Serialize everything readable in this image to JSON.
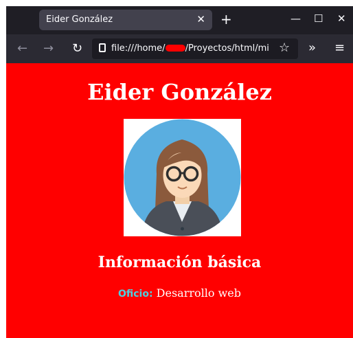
{
  "tab": {
    "title": "Eider González"
  },
  "window": {
    "minimize": "—",
    "maximize": "☐",
    "close": "✕"
  },
  "nav": {
    "back": "←",
    "forward": "→",
    "reload": "↻",
    "url_prefix": "file:///home/",
    "url_suffix": "/Proyectos/html/mi",
    "star": "☆",
    "overflow": "»",
    "menu": "≡"
  },
  "page": {
    "title": "Eider González",
    "section_title": "Información básica",
    "info_label": "Oficio:",
    "info_value": " Desarrollo web"
  },
  "colors": {
    "background": "#ff0000",
    "label": "#4dd0e1",
    "avatar_bg": "#5aaee0"
  },
  "icons": [
    "page-icon",
    "star-icon",
    "overflow-icon",
    "menu-icon",
    "reload-icon",
    "back-icon",
    "forward-icon",
    "close-icon"
  ]
}
